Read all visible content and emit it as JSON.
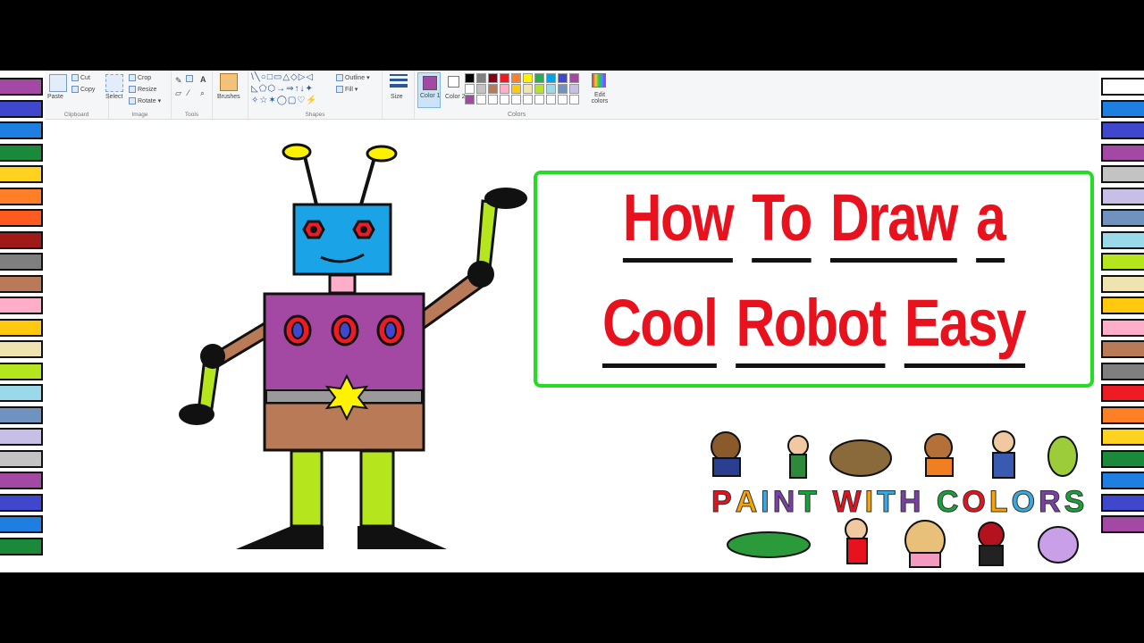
{
  "title": {
    "line1": [
      "How",
      "To",
      "Draw",
      "a"
    ],
    "line2": [
      "Cool",
      "Robot",
      "Easy"
    ]
  },
  "brand": {
    "text": "PAINT WITH COLORS",
    "letter_colors": [
      "#e8121e",
      "#f7a400",
      "#3aa8e0",
      "#7c3fa8",
      "#1aa23a",
      "#e8121e",
      "#f7a400",
      "#3aa8e0",
      "#7c3fa8",
      "#1aa23a",
      "#e8121e",
      "#f7a400",
      "#3aa8e0",
      "#7c3fa8",
      "#1aa23a",
      "#e8121e",
      "#f7a400"
    ]
  },
  "ribbon": {
    "clipboard": {
      "paste": "Paste",
      "cut": "Cut",
      "copy": "Copy",
      "label": "Clipboard"
    },
    "image": {
      "select": "Select",
      "crop": "Crop",
      "resize": "Resize",
      "rotate": "Rotate",
      "label": "Image"
    },
    "tools": {
      "label": "Tools",
      "brushes": "Brushes"
    },
    "shapes": {
      "outline": "Outline",
      "fill": "Fill",
      "label": "Shapes"
    },
    "size": {
      "label": "Size"
    },
    "colors": {
      "color1": "Color 1",
      "color2": "Color 2",
      "edit": "Edit colors",
      "label": "Colors",
      "palette": [
        "#000000",
        "#7f7f7f",
        "#880015",
        "#ed1c24",
        "#ff7f27",
        "#fff200",
        "#22b14c",
        "#00a2e8",
        "#3f48cc",
        "#a349a4",
        "#ffffff",
        "#c3c3c3",
        "#b97a57",
        "#ffaec9",
        "#ffc90e",
        "#efe4b0",
        "#b5e61d",
        "#99d9ea",
        "#7092be",
        "#c8bfe7",
        "#a349a4",
        "#ffffff",
        "#ffffff",
        "#ffffff",
        "#ffffff",
        "#ffffff",
        "#ffffff",
        "#ffffff",
        "#ffffff",
        "#ffffff"
      ]
    }
  },
  "crayons_left": [
    "#a349a4",
    "#3f48cc",
    "#1e7fe0",
    "#1a8a3a",
    "#ffd21f",
    "#ff7f27",
    "#ff5a1f",
    "#a01a1a",
    "#7f7f7f",
    "#b97a57",
    "#ffaec9",
    "#ffc90e",
    "#efe4b0",
    "#b5e61d",
    "#99d9ea",
    "#7092be",
    "#c8bfe7",
    "#c3c3c3",
    "#a349a4",
    "#3f48cc",
    "#1e7fe0",
    "#1a8a3a"
  ],
  "crayons_right": [
    "#ffffff",
    "#1e7fe0",
    "#3f48cc",
    "#a349a4",
    "#c3c3c3",
    "#c8bfe7",
    "#7092be",
    "#99d9ea",
    "#b5e61d",
    "#efe4b0",
    "#ffc90e",
    "#ffaec9",
    "#b97a57",
    "#7f7f7f",
    "#ed1c24",
    "#ff7f27",
    "#ffd21f",
    "#1a8a3a",
    "#1e7fe0",
    "#3f48cc",
    "#a349a4"
  ],
  "robot_colors": {
    "head": "#1ba3e8",
    "body": "#a349a4",
    "belt_gray": "#9a9a9a",
    "skirt": "#b97a57",
    "limb_green": "#b5e61d",
    "arm_brown": "#b97a57",
    "neck": "#ffaec9",
    "antenna_tip": "#fff200",
    "eye_red": "#ed1c24",
    "star": "#fff200",
    "button_ring": "#ed1c24",
    "button_center": "#3f48cc"
  }
}
